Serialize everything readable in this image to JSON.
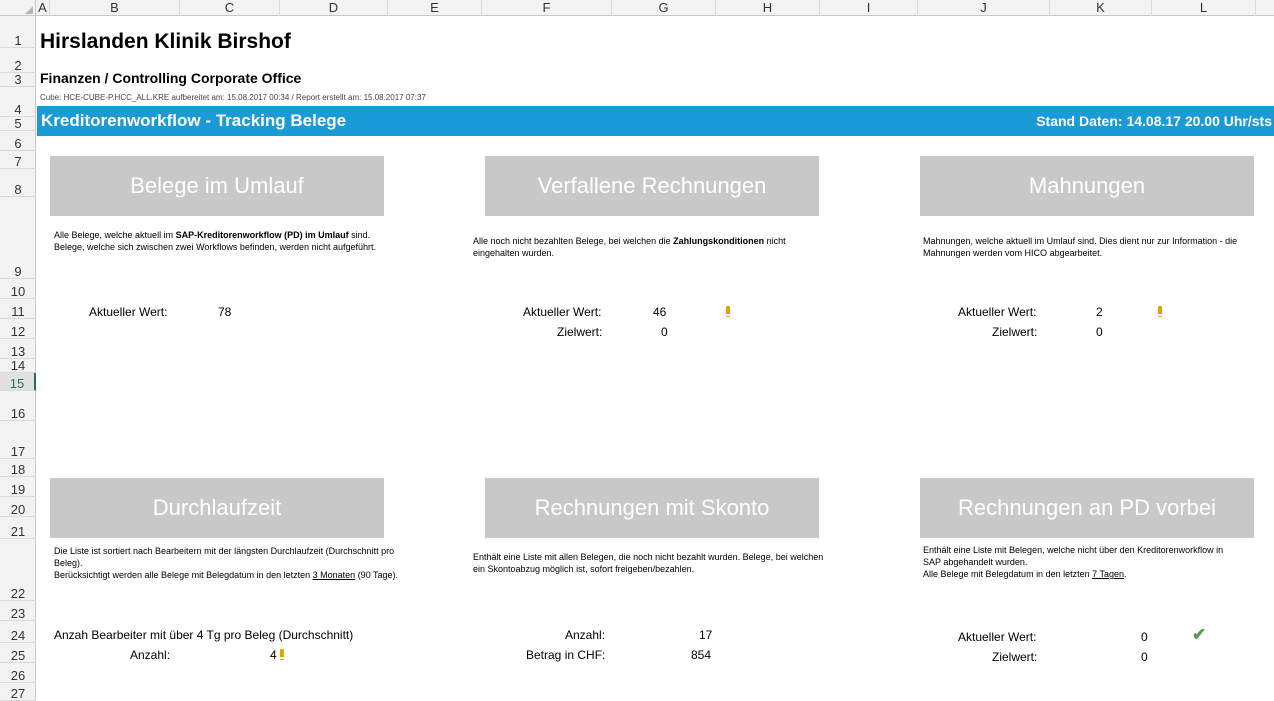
{
  "columns": [
    "A",
    "B",
    "C",
    "D",
    "E",
    "F",
    "G",
    "H",
    "I",
    "J",
    "K",
    "L"
  ],
  "rows": [
    "1",
    "2",
    "3",
    "4",
    "5",
    "6",
    "7",
    "8",
    "9",
    "10",
    "11",
    "12",
    "13",
    "14",
    "15",
    "16",
    "17",
    "18",
    "19",
    "20",
    "21",
    "22",
    "23",
    "24",
    "25",
    "26",
    "27"
  ],
  "selected_row": "15",
  "header": {
    "title": "Hirslanden Klinik Birshof",
    "subtitle": "Finanzen / Controlling Corporate Office",
    "meta": "Cube: HCE-CUBE-P.HCC_ALL.KRE aufbereitet am: 15.08.2017 00:34 /  Report erstellt am: 15.08.2017 07:37"
  },
  "banner": {
    "title": "Kreditorenworkflow - Tracking Belege",
    "stand": "Stand Daten: 14.08.17 20.00 Uhr/sts",
    "color": "#1a9ad6"
  },
  "tiles": {
    "belege": {
      "title": "Belege im Umlauf",
      "desc_1": "Alle Belege, welche aktuell im ",
      "desc_bold": "SAP-Kreditorenworkflow (PD) im Umlauf",
      "desc_2": " sind. Belege, welche sich zwischen zwei Workflows befinden, werden nicht aufgeführt.",
      "aktueller_label": "Aktueller Wert:",
      "aktueller_value": "78"
    },
    "verfallene": {
      "title": "Verfallene Rechnungen",
      "desc_1": "Alle noch nicht bezahlten Belege, bei welchen die ",
      "desc_bold": "Zahlungskonditionen",
      "desc_2": " nicht eingehalten wurden.",
      "aktueller_label": "Aktueller Wert:",
      "aktueller_value": "46",
      "ziel_label": "Zielwert:",
      "ziel_value": "0",
      "status_icon": "warning-icon"
    },
    "mahnungen": {
      "title": "Mahnungen",
      "desc": "Mahnungen, welche aktuell im Umlauf sind. Dies dient nur zur Information - die Mahnungen werden vom HICO abgearbeitet.",
      "aktueller_label": "Aktueller Wert:",
      "aktueller_value": "2",
      "ziel_label": "Zielwert:",
      "ziel_value": "0",
      "status_icon": "warning-icon"
    },
    "durchlaufzeit": {
      "title": "Durchlaufzeit",
      "desc_1": "Die Liste ist sortiert nach Bearbeitern mit der längsten Durchlaufzeit (Durchschnitt pro Beleg).",
      "desc_2": "Berücksichtigt werden alle Belege mit Belegdatum in den letzten ",
      "desc_u": "3 Monaten",
      "desc_3": " (90 Tage).",
      "bearbeiter_label": "Anzah Bearbeiter mit über 4 Tg pro Beleg (Durchschnitt)",
      "anzahl_label": "Anzahl:",
      "anzahl_value": "4",
      "status_icon": "warning-icon"
    },
    "skonto": {
      "title": "Rechnungen mit Skonto",
      "desc": "Enthält eine Liste mit allen Belegen, die noch nicht bezahlt wurden. Belege, bei welchen ein Skontoabzug möglich ist, sofort freigeben/bezahlen.",
      "anzahl_label": "Anzahl:",
      "anzahl_value": "17",
      "betrag_label": "Betrag in CHF:",
      "betrag_value": "854"
    },
    "pd_vorbei": {
      "title": "Rechnungen an PD vorbei",
      "desc_1": "Enthält eine Liste mit Belegen, welche nicht über den Kreditorenworkflow in SAP abgehandelt wurden.",
      "desc_2": "Alle Belege mit Belegdatum in den letzten ",
      "desc_u": "7 Tagen",
      "desc_3": ".",
      "aktueller_label": "Aktueller Wert:",
      "aktueller_value": "0",
      "ziel_label": "Zielwert:",
      "ziel_value": "0",
      "status_icon": "check-icon"
    }
  }
}
